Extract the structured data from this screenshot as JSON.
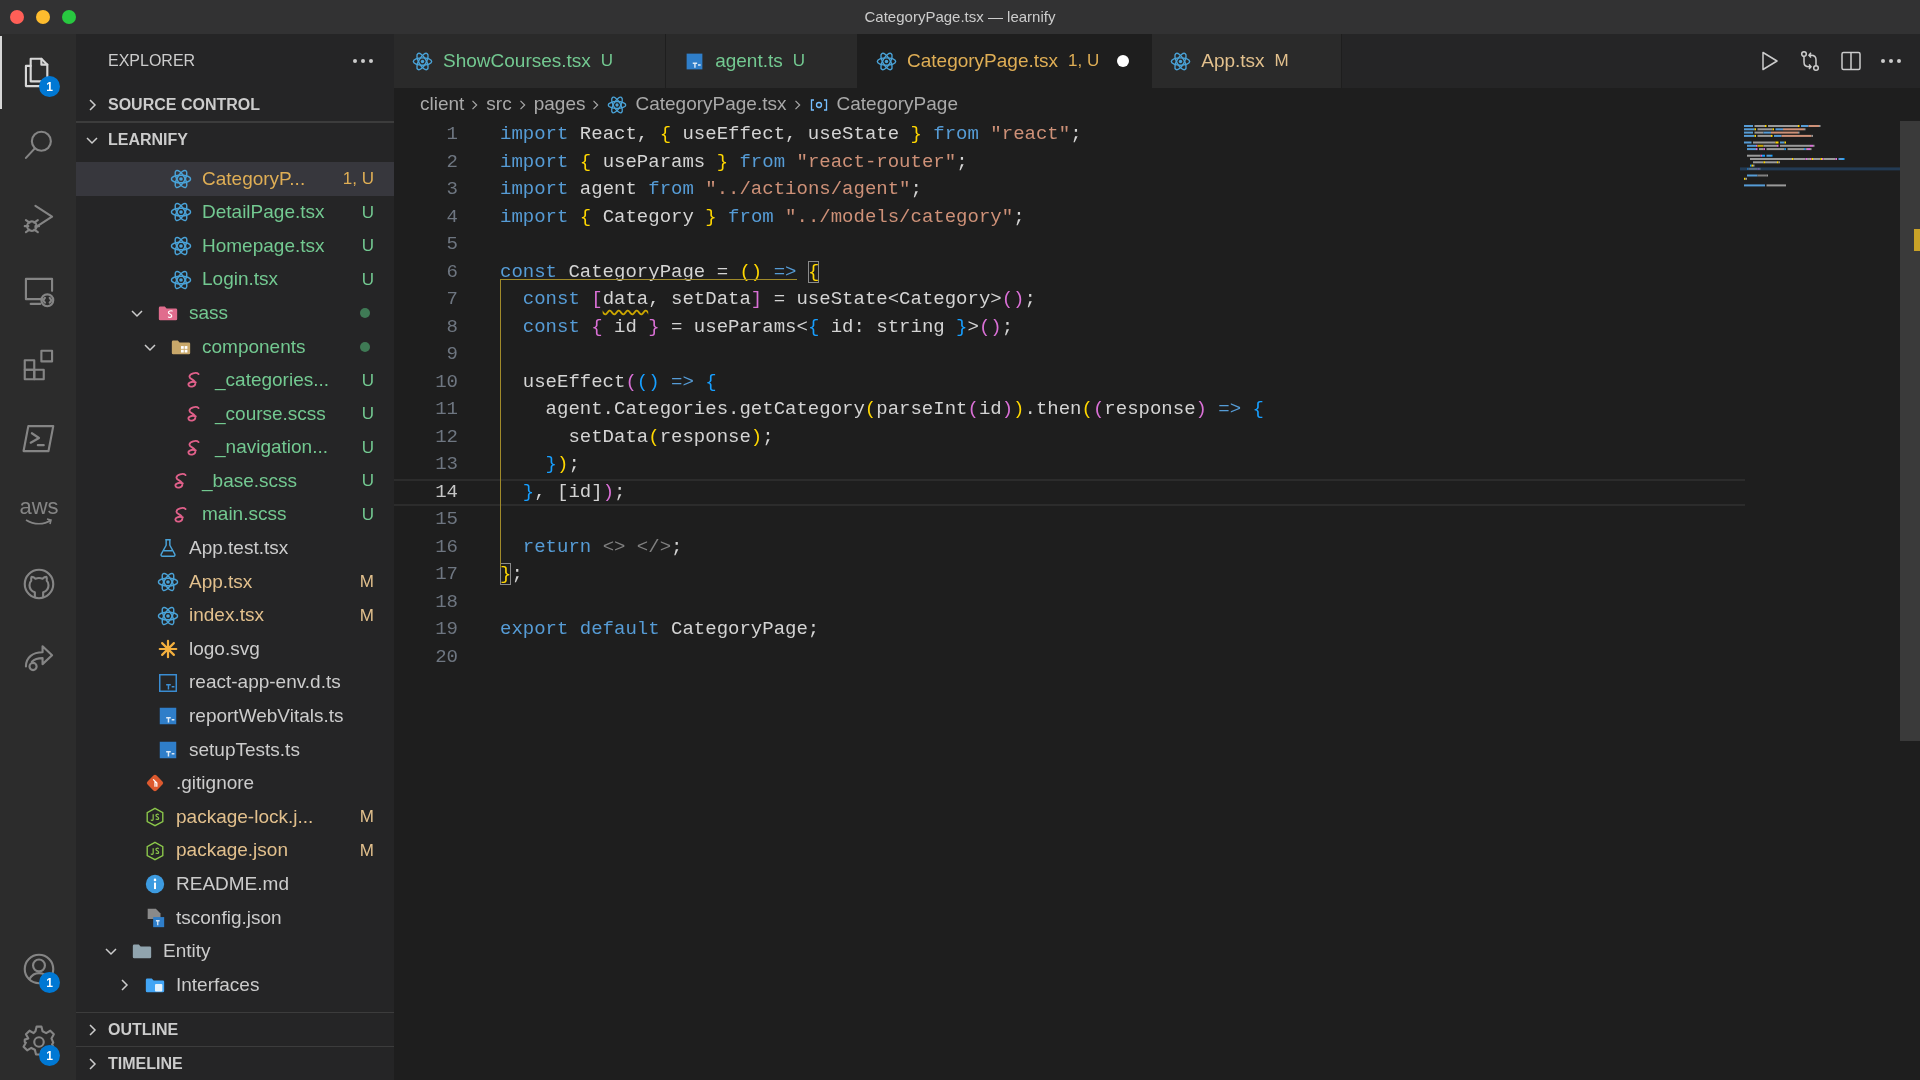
{
  "window": {
    "title": "CategoryPage.tsx — learnify"
  },
  "activity_bar": [
    {
      "kind": "files",
      "selected": true,
      "badge": "1"
    },
    {
      "kind": "search",
      "selected": false
    },
    {
      "kind": "debug",
      "selected": false
    },
    {
      "kind": "remote",
      "selected": false
    },
    {
      "kind": "extensions",
      "selected": false
    },
    {
      "kind": "terminal",
      "selected": false
    },
    {
      "kind": "text",
      "label": "aws",
      "selected": false
    },
    {
      "kind": "repo",
      "selected": false
    },
    {
      "kind": "share",
      "selected": false
    }
  ],
  "activity_bar_bottom": [
    {
      "kind": "account",
      "badge": "1"
    },
    {
      "kind": "settings",
      "badge": "1"
    }
  ],
  "sidebar": {
    "title": "EXPLORER",
    "sections_top": [
      {
        "label": "SOURCE CONTROL",
        "expanded": false
      },
      {
        "label": "LEARNIFY",
        "expanded": true
      }
    ],
    "tree": [
      {
        "children": [
          {
            "children": [
              {
                "children": [
                  {
                    "label": "CategoryP...",
                    "kind": "react",
                    "color": "#dfae55",
                    "badge": "1, U",
                    "selected": true
                  },
                  {
                    "label": "DetailPage.tsx",
                    "kind": "react",
                    "color": "#73c991",
                    "badge": "U",
                    "selected": false
                  },
                  {
                    "label": "Homepage.tsx",
                    "kind": "react",
                    "color": "#73c991",
                    "badge": "U",
                    "selected": false
                  },
                  {
                    "label": "Login.tsx",
                    "kind": "react",
                    "color": "#73c991",
                    "badge": "U",
                    "selected": false
                  }
                ]
              },
              {
                "label": "sass",
                "kind": "folder-sass",
                "color": "#73c991",
                "dot": true,
                "expanded": true,
                "selected": false,
                "children": [
                  {
                    "label": "components",
                    "kind": "folder-components",
                    "color": "#73c991",
                    "dot": true,
                    "expanded": true,
                    "selected": false,
                    "children": [
                      {
                        "label": "_categories...",
                        "kind": "sass",
                        "color": "#73c991",
                        "badge": "U",
                        "selected": false
                      },
                      {
                        "label": "_course.scss",
                        "kind": "sass",
                        "color": "#73c991",
                        "badge": "U",
                        "selected": false
                      },
                      {
                        "label": "_navigation...",
                        "kind": "sass",
                        "color": "#73c991",
                        "badge": "U",
                        "selected": false
                      }
                    ]
                  },
                  {
                    "label": "_base.scss",
                    "kind": "sass",
                    "color": "#73c991",
                    "badge": "U",
                    "selected": false
                  },
                  {
                    "label": "main.scss",
                    "kind": "sass",
                    "color": "#73c991",
                    "badge": "U",
                    "selected": false
                  }
                ]
              },
              {
                "label": "App.test.tsx",
                "kind": "test",
                "color": "#cccccc",
                "selected": false
              },
              {
                "label": "App.tsx",
                "kind": "react",
                "color": "#e2c08d",
                "badge": "M",
                "selected": false
              },
              {
                "label": "index.tsx",
                "kind": "react",
                "color": "#e2c08d",
                "badge": "M",
                "selected": false
              },
              {
                "label": "logo.svg",
                "kind": "svg",
                "color": "#cccccc",
                "selected": false
              },
              {
                "label": "react-app-env.d.ts",
                "kind": "ts-outline",
                "color": "#cccccc",
                "selected": false
              },
              {
                "label": "reportWebVitals.ts",
                "kind": "ts",
                "color": "#cccccc",
                "selected": false
              },
              {
                "label": "setupTests.ts",
                "kind": "ts",
                "color": "#cccccc",
                "selected": false
              }
            ]
          },
          {
            "label": ".gitignore",
            "kind": "git",
            "color": "#cccccc",
            "selected": false
          },
          {
            "label": "package-lock.j...",
            "kind": "node",
            "color": "#e2c08d",
            "badge": "M",
            "selected": false
          },
          {
            "label": "package.json",
            "kind": "node",
            "color": "#e2c08d",
            "badge": "M",
            "selected": false
          },
          {
            "label": "README.md",
            "kind": "info",
            "color": "#cccccc",
            "selected": false
          },
          {
            "label": "tsconfig.json",
            "kind": "tsconfig",
            "color": "#cccccc",
            "selected": false
          }
        ]
      },
      {
        "label": "Entity",
        "kind": "folder",
        "color": "#cccccc",
        "expanded": true,
        "selected": false,
        "children": [
          {
            "label": "Interfaces",
            "kind": "folder-blue",
            "color": "#cccccc",
            "expanded": false,
            "selected": false
          }
        ]
      }
    ],
    "sections_bottom": [
      {
        "label": "OUTLINE",
        "expanded": false
      },
      {
        "label": "TIMELINE",
        "expanded": false
      }
    ]
  },
  "tabs": [
    {
      "label": "ShowCourses.tsx",
      "badge": "U",
      "kind": "react",
      "color": "#73c991",
      "selected": false,
      "dirty": false
    },
    {
      "label": "agent.ts",
      "badge": "U",
      "kind": "ts",
      "color": "#73c991",
      "selected": false,
      "dirty": false
    },
    {
      "label": "CategoryPage.tsx",
      "badge": "1, U",
      "kind": "react",
      "color": "#dfae55",
      "selected": true,
      "dirty": true
    },
    {
      "label": "App.tsx",
      "badge": "M",
      "kind": "react",
      "color": "#e2c08d",
      "selected": false,
      "dirty": false
    }
  ],
  "breadcrumb": [
    {
      "label": "client",
      "kind": "folder"
    },
    {
      "label": "src",
      "kind": "folder"
    },
    {
      "label": "pages",
      "kind": "folder"
    },
    {
      "label": "CategoryPage.tsx",
      "kind": "file"
    },
    {
      "label": "CategoryPage",
      "kind": "symbol"
    }
  ],
  "code": [
    {
      "number": "1",
      "current": false,
      "tokens": [
        {
          "kind": "kw",
          "text": "import"
        },
        {
          "kind": "id",
          "text": " React, "
        },
        {
          "kind": "b1",
          "text": "{"
        },
        {
          "kind": "id",
          "text": " useEffect, useState "
        },
        {
          "kind": "b1",
          "text": "}"
        },
        {
          "kind": "kw",
          "text": " from "
        },
        {
          "kind": "str",
          "text": "\"react\""
        },
        {
          "kind": "id",
          "text": ";"
        }
      ]
    },
    {
      "number": "2",
      "current": false,
      "tokens": [
        {
          "kind": "kw",
          "text": "import "
        },
        {
          "kind": "b1",
          "text": "{"
        },
        {
          "kind": "id",
          "text": " useParams "
        },
        {
          "kind": "b1",
          "text": "}"
        },
        {
          "kind": "kw",
          "text": " from "
        },
        {
          "kind": "str",
          "text": "\"react-router\""
        },
        {
          "kind": "id",
          "text": ";"
        }
      ]
    },
    {
      "number": "3",
      "current": false,
      "tokens": [
        {
          "kind": "kw",
          "text": "import"
        },
        {
          "kind": "id",
          "text": " agent "
        },
        {
          "kind": "kw",
          "text": "from "
        },
        {
          "kind": "str",
          "text": "\"../actions/agent\""
        },
        {
          "kind": "id",
          "text": ";"
        }
      ]
    },
    {
      "number": "4",
      "current": false,
      "tokens": [
        {
          "kind": "kw",
          "text": "import "
        },
        {
          "kind": "b1",
          "text": "{"
        },
        {
          "kind": "id",
          "text": " Category "
        },
        {
          "kind": "b1",
          "text": "}"
        },
        {
          "kind": "kw",
          "text": " from "
        },
        {
          "kind": "str",
          "text": "\"../models/category\""
        },
        {
          "kind": "id",
          "text": ";"
        }
      ]
    },
    {
      "number": "5",
      "current": false
    },
    {
      "number": "6",
      "current": false,
      "tokens": [
        {
          "kind": "kw",
          "text": "const"
        },
        {
          "kind": "id",
          "text": " CategoryPage = "
        },
        {
          "kind": "b1",
          "text": "()"
        },
        {
          "kind": "kw",
          "text": " => "
        },
        {
          "kind": "match",
          "text": "{"
        }
      ]
    },
    {
      "number": "7",
      "current": false,
      "tokens": [
        {
          "kind": "kw",
          "text": "  const "
        },
        {
          "kind": "b2",
          "text": "["
        },
        {
          "kind": "warn",
          "text": "data"
        },
        {
          "kind": "id",
          "text": ", setData"
        },
        {
          "kind": "b2",
          "text": "]"
        },
        {
          "kind": "id",
          "text": " = useState<Category>"
        },
        {
          "kind": "b2",
          "text": "()"
        },
        {
          "kind": "id",
          "text": ";"
        }
      ]
    },
    {
      "number": "8",
      "current": false,
      "tokens": [
        {
          "kind": "kw",
          "text": "  const "
        },
        {
          "kind": "b2",
          "text": "{"
        },
        {
          "kind": "id",
          "text": " id "
        },
        {
          "kind": "b2",
          "text": "}"
        },
        {
          "kind": "id",
          "text": " = useParams<"
        },
        {
          "kind": "b3",
          "text": "{"
        },
        {
          "kind": "id",
          "text": " id: string "
        },
        {
          "kind": "b3",
          "text": "}"
        },
        {
          "kind": "id",
          "text": ">"
        },
        {
          "kind": "b2",
          "text": "()"
        },
        {
          "kind": "id",
          "text": ";"
        }
      ]
    },
    {
      "number": "9",
      "current": false
    },
    {
      "number": "10",
      "current": false,
      "tokens": [
        {
          "kind": "id",
          "text": "  useEffect"
        },
        {
          "kind": "b2",
          "text": "("
        },
        {
          "kind": "b3",
          "text": "()"
        },
        {
          "kind": "kw",
          "text": " => "
        },
        {
          "kind": "b3",
          "text": "{"
        }
      ]
    },
    {
      "number": "11",
      "current": false,
      "tokens": [
        {
          "kind": "id",
          "text": "    agent.Categories.getCategory"
        },
        {
          "kind": "b1",
          "text": "("
        },
        {
          "kind": "id",
          "text": "parseInt"
        },
        {
          "kind": "b2",
          "text": "("
        },
        {
          "kind": "id",
          "text": "id"
        },
        {
          "kind": "b2",
          "text": ")"
        },
        {
          "kind": "b1",
          "text": ")"
        },
        {
          "kind": "id",
          "text": ".then"
        },
        {
          "kind": "b1",
          "text": "("
        },
        {
          "kind": "b2",
          "text": "("
        },
        {
          "kind": "id",
          "text": "response"
        },
        {
          "kind": "b2",
          "text": ")"
        },
        {
          "kind": "kw",
          "text": " => "
        },
        {
          "kind": "b3",
          "text": "{"
        }
      ]
    },
    {
      "number": "12",
      "current": false,
      "tokens": [
        {
          "kind": "id",
          "text": "      setData"
        },
        {
          "kind": "b1",
          "text": "("
        },
        {
          "kind": "id",
          "text": "response"
        },
        {
          "kind": "b1",
          "text": ")"
        },
        {
          "kind": "id",
          "text": ";"
        }
      ]
    },
    {
      "number": "13",
      "current": false,
      "tokens": [
        {
          "kind": "b3",
          "text": "    }"
        },
        {
          "kind": "b1",
          "text": ")"
        },
        {
          "kind": "id",
          "text": ";"
        }
      ]
    },
    {
      "number": "14",
      "current": true,
      "tokens": [
        {
          "kind": "b3",
          "text": "  }"
        },
        {
          "kind": "id",
          "text": ", [id]"
        },
        {
          "kind": "b2",
          "text": ")"
        },
        {
          "kind": "id",
          "text": ";"
        }
      ]
    },
    {
      "number": "15",
      "current": false
    },
    {
      "number": "16",
      "current": false,
      "tokens": [
        {
          "kind": "kw",
          "text": "  return "
        },
        {
          "kind": "tag",
          "text": "<> </>"
        },
        {
          "kind": "id",
          "text": ";"
        }
      ]
    },
    {
      "number": "17",
      "current": false,
      "tokens": [
        {
          "kind": "match",
          "text": "}"
        },
        {
          "kind": "id",
          "text": ";"
        }
      ]
    },
    {
      "number": "18",
      "current": false
    },
    {
      "number": "19",
      "current": false,
      "tokens": [
        {
          "kind": "kw",
          "text": "export default"
        },
        {
          "kind": "id",
          "text": " CategoryPage;"
        }
      ]
    },
    {
      "number": "20",
      "current": false
    }
  ]
}
